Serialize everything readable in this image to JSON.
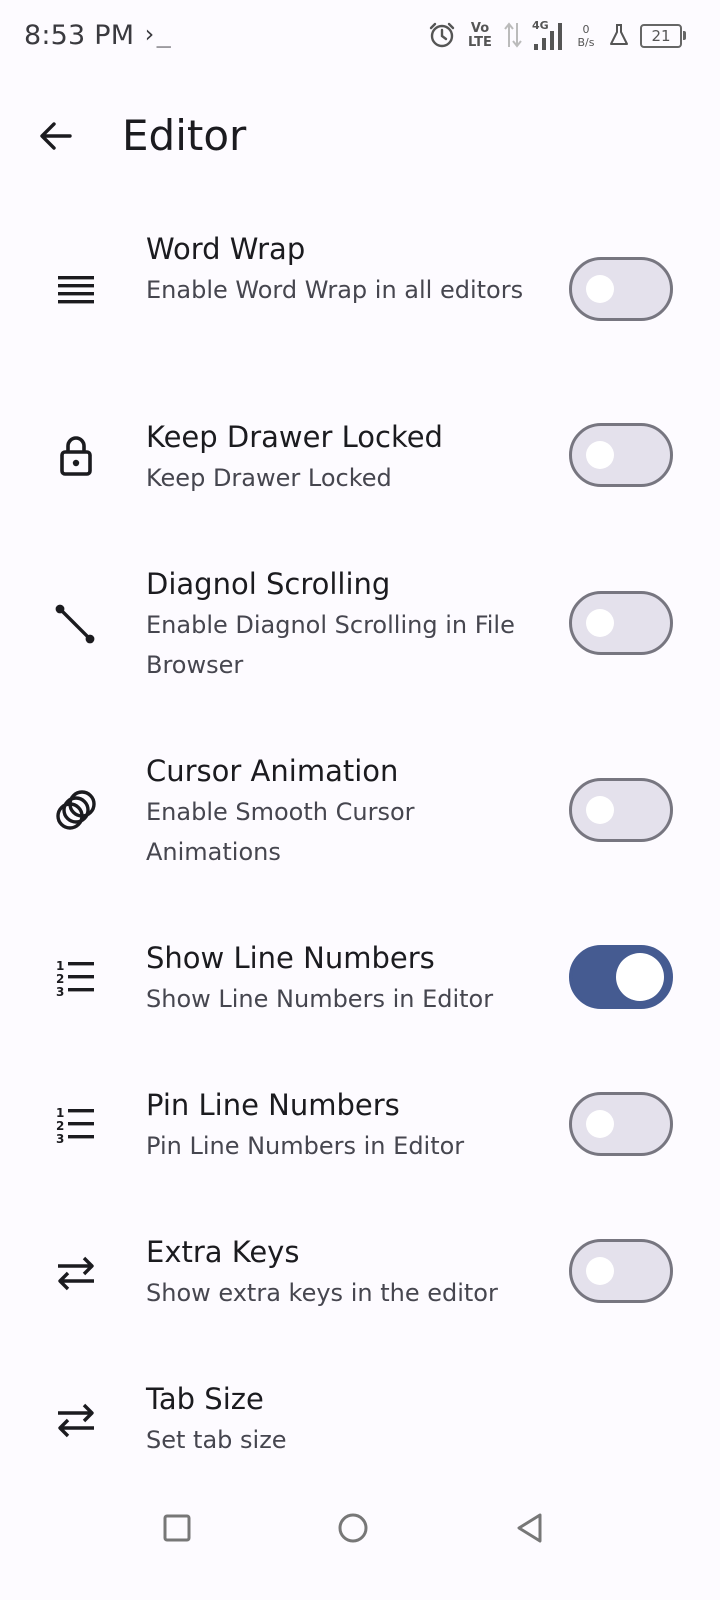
{
  "status_bar": {
    "time": "8:53 PM",
    "terminal_glyph": "›_",
    "volte_top": "Vo",
    "volte_bottom": "LTE",
    "network_type": "4G",
    "speed_value": "0",
    "speed_unit": "B/s",
    "battery": "21"
  },
  "app_bar": {
    "title": "Editor",
    "back_icon": "arrow-back-icon"
  },
  "settings": [
    {
      "icon": "wrap-lines-icon",
      "title": "Word Wrap",
      "description": "Enable Word Wrap in all editors",
      "enabled": false
    },
    {
      "icon": "lock-icon",
      "title": "Keep Drawer Locked",
      "description": "Keep Drawer Locked",
      "enabled": false
    },
    {
      "icon": "diagonal-line-icon",
      "title": "Diagnol Scrolling",
      "description": "Enable Diagnol Scrolling in File Browser",
      "enabled": false
    },
    {
      "icon": "animation-icon",
      "title": "Cursor Animation",
      "description": "Enable Smooth Cursor Animations",
      "enabled": false
    },
    {
      "icon": "numbered-list-icon",
      "title": "Show Line Numbers",
      "description": "Show Line Numbers in Editor",
      "enabled": true
    },
    {
      "icon": "numbered-list-icon",
      "title": "Pin Line Numbers",
      "description": "Pin Line Numbers in Editor",
      "enabled": false
    },
    {
      "icon": "swap-arrows-icon",
      "title": "Extra Keys",
      "description": "Show extra keys in the editor",
      "enabled": false
    },
    {
      "icon": "swap-arrows-icon",
      "title": "Tab Size",
      "description": "Set tab size"
    }
  ],
  "colors": {
    "background": "#fdfbff",
    "switch_on": "#455b91",
    "switch_off_track": "#e4e1ec",
    "switch_off_border": "#777680"
  },
  "nav_bar": {
    "recents_icon": "square-icon",
    "home_icon": "circle-icon",
    "back_icon": "triangle-back-icon"
  }
}
